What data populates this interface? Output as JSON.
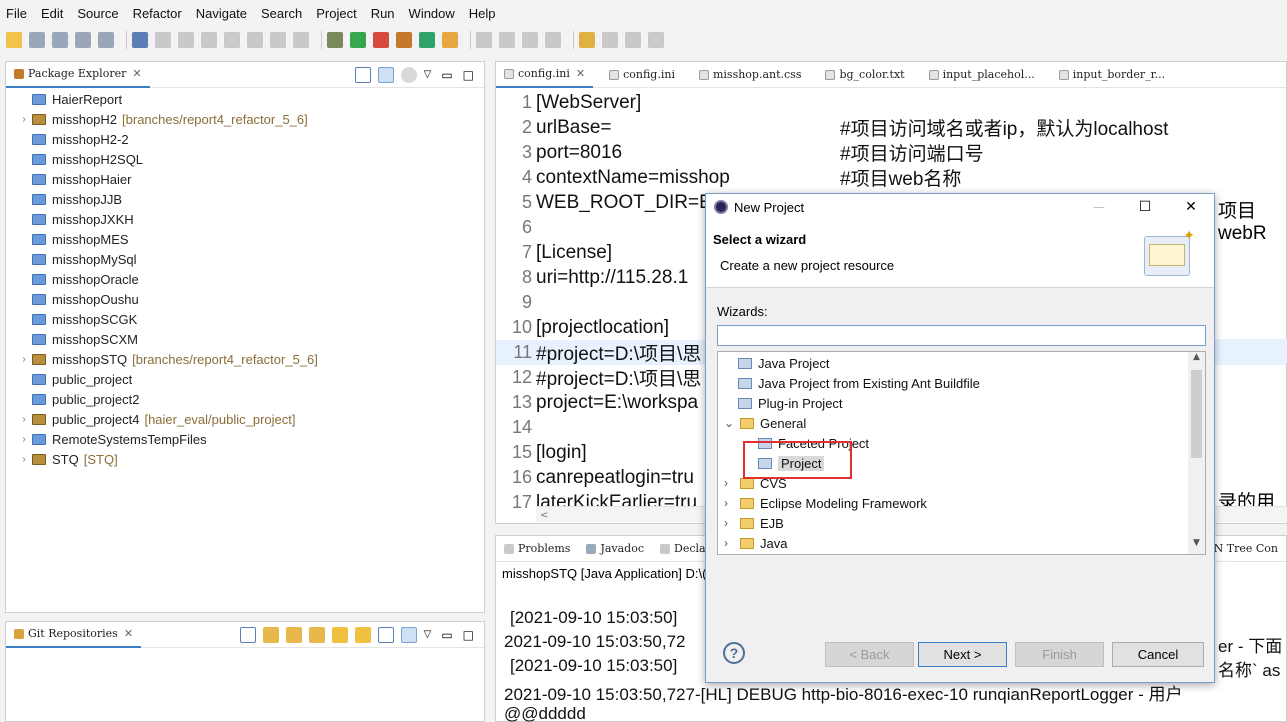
{
  "menubar": {
    "items": [
      "File",
      "Edit",
      "Source",
      "Refactor",
      "Navigate",
      "Search",
      "Project",
      "Run",
      "Window",
      "Help"
    ]
  },
  "package_explorer": {
    "title": "Package Explorer",
    "items": [
      {
        "label": "HaierReport",
        "extra": "",
        "expandable": false,
        "svn": false
      },
      {
        "label": "misshopH2",
        "extra": "[branches/report4_refactor_5_6]",
        "expandable": true,
        "svn": true
      },
      {
        "label": "misshopH2-2",
        "extra": "",
        "expandable": false,
        "svn": false
      },
      {
        "label": "misshopH2SQL",
        "extra": "",
        "expandable": false,
        "svn": false
      },
      {
        "label": "misshopHaier",
        "extra": "",
        "expandable": false,
        "svn": false
      },
      {
        "label": "misshopJJB",
        "extra": "",
        "expandable": false,
        "svn": false
      },
      {
        "label": "misshopJXKH",
        "extra": "",
        "expandable": false,
        "svn": false
      },
      {
        "label": "misshopMES",
        "extra": "",
        "expandable": false,
        "svn": false
      },
      {
        "label": "misshopMySql",
        "extra": "",
        "expandable": false,
        "svn": false
      },
      {
        "label": "misshopOracle",
        "extra": "",
        "expandable": false,
        "svn": false
      },
      {
        "label": "misshopOushu",
        "extra": "",
        "expandable": false,
        "svn": false
      },
      {
        "label": "misshopSCGK",
        "extra": "",
        "expandable": false,
        "svn": false
      },
      {
        "label": "misshopSCXM",
        "extra": "",
        "expandable": false,
        "svn": false
      },
      {
        "label": "misshopSTQ",
        "extra": "[branches/report4_refactor_5_6]",
        "expandable": true,
        "svn": true
      },
      {
        "label": "public_project",
        "extra": "",
        "expandable": false,
        "svn": false
      },
      {
        "label": "public_project2",
        "extra": "",
        "expandable": false,
        "svn": false
      },
      {
        "label": "public_project4",
        "extra": "[haier_eval/public_project]",
        "expandable": true,
        "svn": true
      },
      {
        "label": "RemoteSystemsTempFiles",
        "extra": "",
        "expandable": true,
        "svn": false
      },
      {
        "label": "STQ",
        "extra": "[STQ]",
        "expandable": true,
        "svn": true
      }
    ]
  },
  "git_repositories": {
    "title": "Git Repositories"
  },
  "editor": {
    "tabs": [
      "config.ini",
      "config.ini",
      "misshop.ant.css",
      "bg_color.txt",
      "input_placehol...",
      "input_border_r..."
    ],
    "lines": [
      {
        "n": "1",
        "code": "[WebServer]",
        "comment": ""
      },
      {
        "n": "2",
        "code": "urlBase=",
        "comment": "#项目访问域名或者ip，默认为localhost"
      },
      {
        "n": "3",
        "code": "port=8016",
        "comment": "#项目访问端口号"
      },
      {
        "n": "4",
        "code": "contextName=misshop",
        "comment": "#项目web名称"
      },
      {
        "n": "5",
        "code": "WEB_ROOT_DIR=E:",
        "comment": ""
      },
      {
        "n": "6",
        "code": "",
        "comment": ""
      },
      {
        "n": "7",
        "code": "[License]",
        "comment": ""
      },
      {
        "n": "8",
        "code": "uri=http://115.28.1",
        "comment": ""
      },
      {
        "n": "9",
        "code": "",
        "comment": ""
      },
      {
        "n": "10",
        "code": "[projectlocation]",
        "comment": ""
      },
      {
        "n": "11",
        "code": "#project=D:\\项目\\思",
        "comment": ""
      },
      {
        "n": "12",
        "code": "#project=D:\\项目\\思",
        "comment": ""
      },
      {
        "n": "13",
        "code": "project=E:\\workspa",
        "comment": ""
      },
      {
        "n": "14",
        "code": "",
        "comment": ""
      },
      {
        "n": "15",
        "code": "[login]",
        "comment": ""
      },
      {
        "n": "16",
        "code": "canrepeatlogin=tru",
        "comment": ""
      },
      {
        "n": "17",
        "code": "laterKickEarlier=tru",
        "comment": ""
      }
    ],
    "right_overflow_5": "项目webR",
    "right_overflow_17": "录的用户"
  },
  "bottom_panel": {
    "tabs": [
      "Problems",
      "Javadoc",
      "Declar"
    ],
    "right_tab": "SVN Tree Con",
    "console_title": "misshopSTQ [Java Application] D:\\(",
    "console_lines": [
      {
        "left": "[2021-09-10 15:03:50]",
        "right": ""
      },
      {
        "left": "2021-09-10 15:03:50,72",
        "right": "er - 下面"
      },
      {
        "left": "[2021-09-10 15:03:50]",
        "right": "名称` as"
      },
      {
        "left": "2021-09-10 15:03:50,727-[HL] DEBUG http-bio-8016-exec-10 runqianReportLogger - 用户",
        "right": ""
      },
      {
        "left": "@@ddddd",
        "right": ""
      }
    ]
  },
  "dialog": {
    "title": "New Project",
    "heading": "Select a wizard",
    "description": "Create a new project resource",
    "wizards_label": "Wizards:",
    "filter_value": "",
    "tree": [
      {
        "label": "Java Project",
        "indent": 1,
        "toggle": ""
      },
      {
        "label": "Java Project from Existing Ant Buildfile",
        "indent": 1,
        "toggle": ""
      },
      {
        "label": "Plug-in Project",
        "indent": 1,
        "toggle": ""
      },
      {
        "label": "General",
        "indent": 0,
        "toggle": "v"
      },
      {
        "label": "Faceted Project",
        "indent": 2,
        "toggle": ""
      },
      {
        "label": "Project",
        "indent": 2,
        "toggle": "",
        "selected": true
      },
      {
        "label": "CVS",
        "indent": 0,
        "toggle": ">"
      },
      {
        "label": "Eclipse Modeling Framework",
        "indent": 0,
        "toggle": ">"
      },
      {
        "label": "EJB",
        "indent": 0,
        "toggle": ">"
      },
      {
        "label": "Java",
        "indent": 0,
        "toggle": ">"
      }
    ],
    "buttons": {
      "back": "< Back",
      "next": "Next >",
      "finish": "Finish",
      "cancel": "Cancel"
    },
    "help_glyph": "?"
  },
  "colors": {
    "selection_highlight": "#e03030",
    "accent": "#3c7fc9"
  }
}
